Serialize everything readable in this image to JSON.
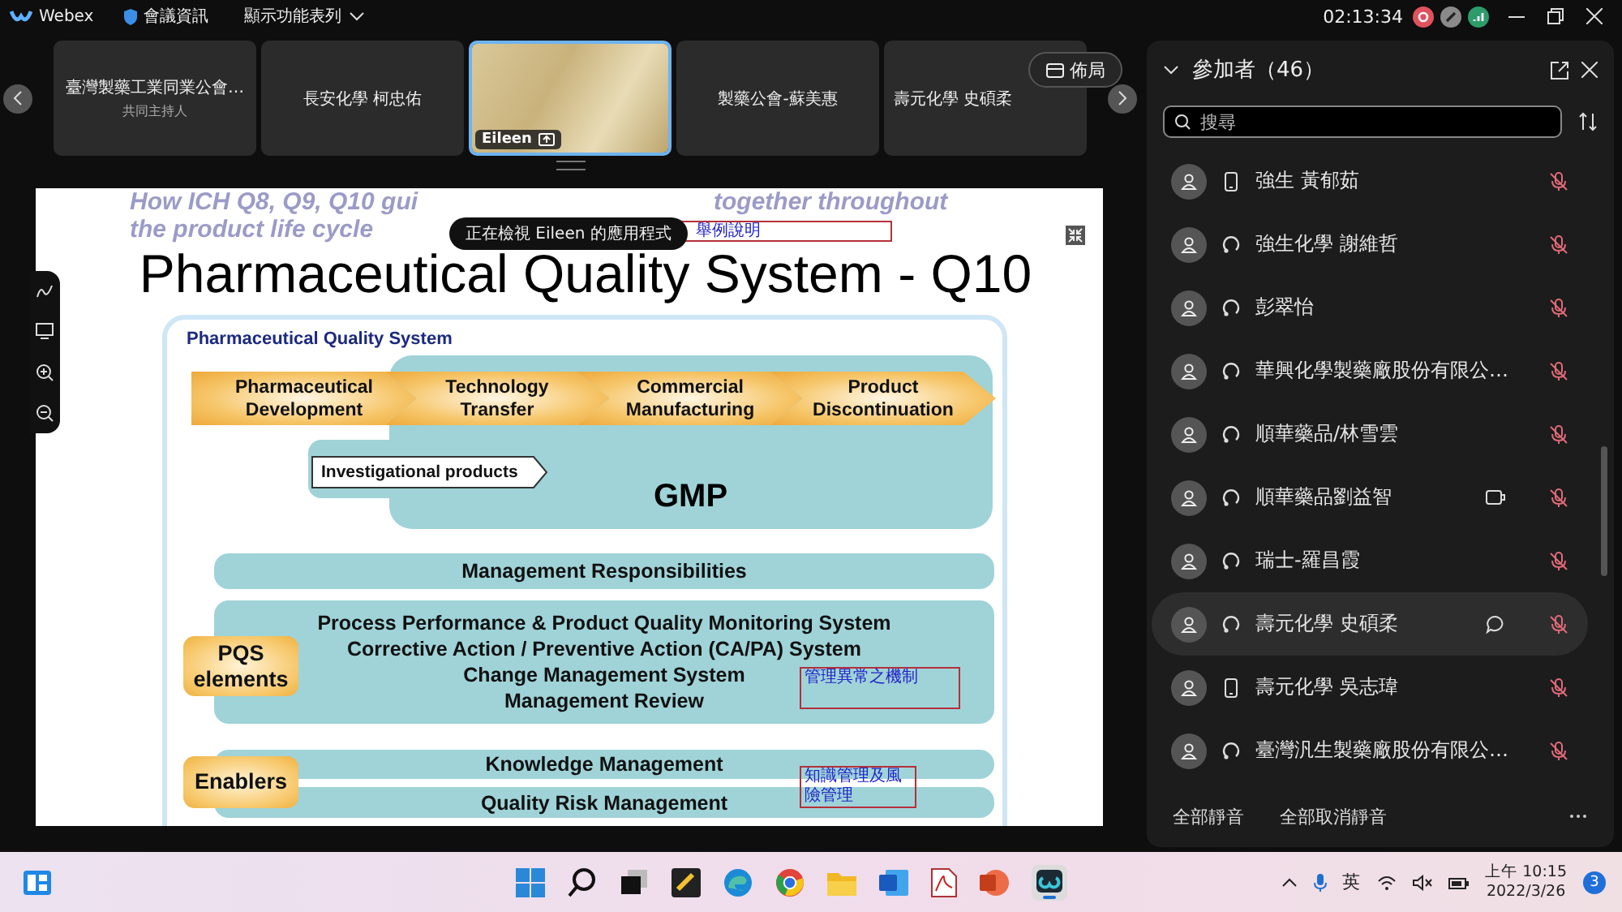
{
  "app": {
    "name": "Webex",
    "meeting_info": "會議資訊",
    "menu_toggle": "顯示功能表列",
    "timer": "02:13:34"
  },
  "video_strip": {
    "tiles": [
      {
        "kind": "name",
        "name": "臺灣製藥工業同業公會…",
        "role": "共同主持人",
        "selected": false
      },
      {
        "kind": "name",
        "name": "長安化學 柯忠佑",
        "selected": false
      },
      {
        "kind": "video",
        "name": "Eileen",
        "selected": true
      },
      {
        "kind": "name",
        "name": "製藥公會-蘇美惠",
        "selected": false
      },
      {
        "kind": "name",
        "name": "壽元化學 史碩柔",
        "selected": false
      }
    ],
    "layout_button": "佈局"
  },
  "share_banner": "正在檢視 Eileen 的應用程式",
  "slide": {
    "heading_left": "How ICH Q8, Q9, Q10 gui",
    "heading_right": "together throughout",
    "subheading": "the product life cycle",
    "note": "舉例說明",
    "title": "Pharmaceutical Quality System - Q10",
    "diagram": {
      "label": "Pharmaceutical Quality System",
      "stages": [
        "Pharmaceutical Development",
        "Technology Transfer",
        "Commercial Manufacturing",
        "Product Discontinuation"
      ],
      "investigational": "Investigational products",
      "gmp": "GMP",
      "management": "Management Responsibilities",
      "pqs_label": "PQS elements",
      "pqs_items": [
        "Process Performance & Product Quality Monitoring System",
        "Corrective Action / Preventive Action  (CA/PA) System",
        "Change Management System",
        "Management Review"
      ],
      "pqs_note": "管理異常之機制",
      "enablers_label": "Enablers",
      "enablers": [
        "Knowledge Management",
        "Quality Risk Management"
      ],
      "enablers_note": "知識管理及風險管理"
    }
  },
  "participants": {
    "title": "參加者（46）",
    "search": {
      "placeholder": "搜尋"
    },
    "items": [
      {
        "kind": "phone",
        "name": "強生 黃郁茹",
        "camera": false,
        "chat": false,
        "muted": true,
        "selected": false
      },
      {
        "kind": "computer",
        "name": "強生化學 謝維哲",
        "camera": false,
        "chat": false,
        "muted": true,
        "selected": false
      },
      {
        "kind": "computer",
        "name": "彭翠怡",
        "camera": false,
        "chat": false,
        "muted": true,
        "selected": false
      },
      {
        "kind": "computer",
        "name": "華興化學製藥廠股份有限公…",
        "camera": false,
        "chat": false,
        "muted": true,
        "selected": false
      },
      {
        "kind": "computer",
        "name": "順華藥品/林雪雲",
        "camera": false,
        "chat": false,
        "muted": true,
        "selected": false
      },
      {
        "kind": "computer",
        "name": "順華藥品劉益智",
        "camera": true,
        "chat": false,
        "muted": true,
        "selected": false
      },
      {
        "kind": "computer",
        "name": "瑞士-羅昌霞",
        "camera": false,
        "chat": false,
        "muted": true,
        "selected": false
      },
      {
        "kind": "computer",
        "name": "壽元化學 史碩柔",
        "camera": false,
        "chat": true,
        "muted": true,
        "selected": true
      },
      {
        "kind": "phone",
        "name": "壽元化學 吳志瑋",
        "camera": false,
        "chat": false,
        "muted": true,
        "selected": false
      },
      {
        "kind": "computer",
        "name": "臺灣汎生製藥廠股份有限公…",
        "camera": false,
        "chat": false,
        "muted": true,
        "selected": false
      }
    ],
    "footer": [
      "全部靜音",
      "全部取消靜音"
    ]
  },
  "taskbar": {
    "input_method": "英",
    "time": "上午 10:15",
    "date": "2022/3/26",
    "notifications": "3"
  }
}
